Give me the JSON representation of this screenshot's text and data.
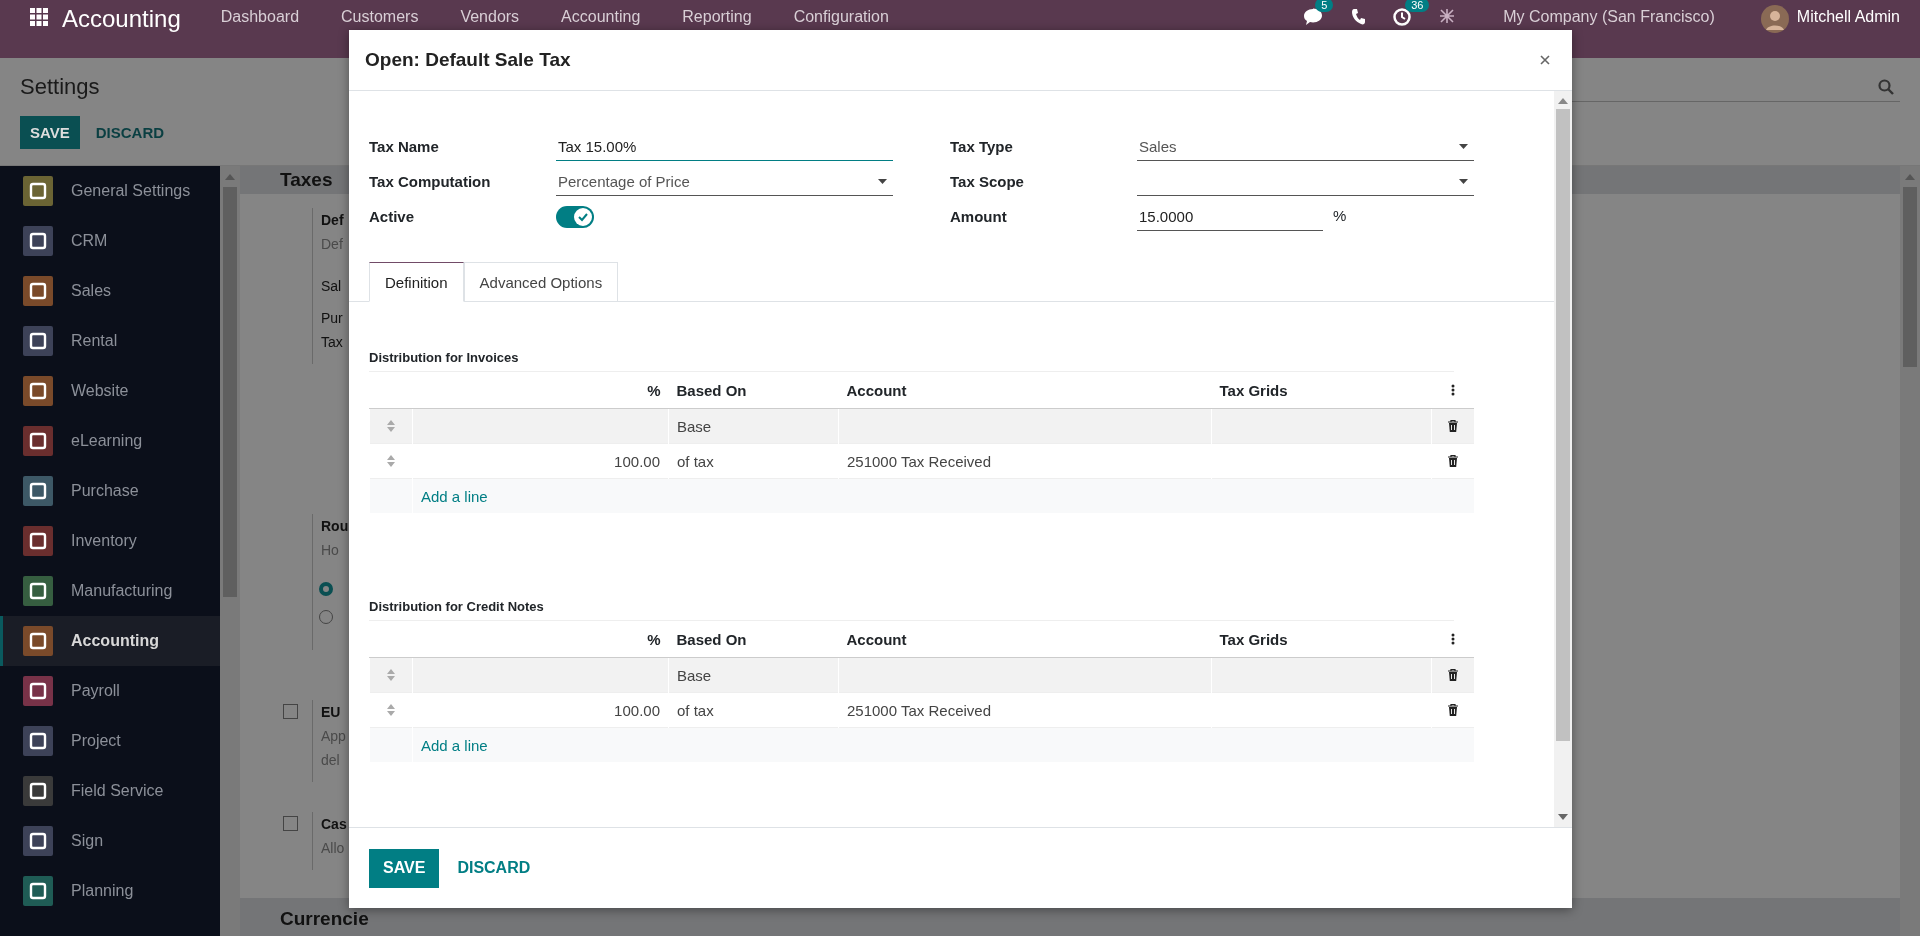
{
  "navbar": {
    "brand": "Accounting",
    "menu": [
      "Dashboard",
      "Customers",
      "Vendors",
      "Accounting",
      "Reporting",
      "Configuration"
    ],
    "messages_badge": "5",
    "activities_badge": "36",
    "company": "My Company (San Francisco)",
    "user": "Mitchell Admin"
  },
  "control_panel": {
    "breadcrumb": "Settings",
    "buttons": [
      "SAVE",
      "DISCARD"
    ]
  },
  "sidebar": {
    "items": [
      {
        "label": "General Settings",
        "color": "#6b6434",
        "selected": false
      },
      {
        "label": "CRM",
        "color": "#3d4258",
        "selected": false
      },
      {
        "label": "Sales",
        "color": "#7a4a2a",
        "selected": false
      },
      {
        "label": "Rental",
        "color": "#3d4258",
        "selected": false
      },
      {
        "label": "Website",
        "color": "#7a4a2a",
        "selected": false
      },
      {
        "label": "eLearning",
        "color": "#6a2e2e",
        "selected": false
      },
      {
        "label": "Purchase",
        "color": "#3d5866",
        "selected": false
      },
      {
        "label": "Inventory",
        "color": "#6a2e2e",
        "selected": false
      },
      {
        "label": "Manufacturing",
        "color": "#365e40",
        "selected": false
      },
      {
        "label": "Accounting",
        "color": "#7a4a2a",
        "selected": true
      },
      {
        "label": "Payroll",
        "color": "#783248",
        "selected": false
      },
      {
        "label": "Project",
        "color": "#3d4258",
        "selected": false
      },
      {
        "label": "Field Service",
        "color": "#3a3a3a",
        "selected": false
      },
      {
        "label": "Sign",
        "color": "#3d4258",
        "selected": false
      },
      {
        "label": "Planning",
        "color": "#1f5c55",
        "selected": false
      }
    ]
  },
  "settings": {
    "section": "Taxes",
    "blocks": [
      {
        "kind": "plain",
        "lines": [
          "Def",
          "Def",
          "Sal",
          "Pur",
          "Tax"
        ]
      },
      {
        "kind": "radio",
        "lines": [
          "Rou",
          "Ho"
        ],
        "radios": [
          {
            "selected": true
          },
          {
            "selected": false
          }
        ]
      },
      {
        "kind": "checkbox",
        "checked": false,
        "lines": [
          "EU",
          "App",
          "del"
        ]
      },
      {
        "kind": "checkbox",
        "checked": false,
        "lines": [
          "Cas",
          "Allo"
        ]
      }
    ],
    "next_section": "Currencie"
  },
  "dialog": {
    "title": "Open: Default Sale Tax",
    "fields": [
      {
        "label": "Tax Name",
        "kind": "input",
        "value": "Tax 15.00%",
        "focused": true
      },
      {
        "label": "Tax Type",
        "kind": "select",
        "value": "Sales"
      },
      {
        "label": "Tax Computation",
        "kind": "select",
        "value": "Percentage of Price"
      },
      {
        "label": "Tax Scope",
        "kind": "select"
      },
      {
        "label": "Active",
        "kind": "toggle",
        "on": true
      },
      {
        "label": "Amount",
        "kind": "input",
        "value": "15.0000",
        "suffix": "%",
        "focused": false
      }
    ],
    "tabs": [
      {
        "label": "Definition",
        "selected": true
      },
      {
        "label": "Advanced Options",
        "selected": false
      }
    ],
    "tables": [
      {
        "title": "Distribution for Invoices",
        "columns": [
          "%",
          "Based On",
          "Account",
          "Tax Grids"
        ],
        "rows": [
          {
            "based_on": "Base"
          },
          {
            "percent": "100.00",
            "based_on": "of tax",
            "account": "251000 Tax Received"
          }
        ],
        "add_line": "Add a line"
      },
      {
        "title": "Distribution for Credit Notes",
        "columns": [
          "%",
          "Based On",
          "Account",
          "Tax Grids"
        ],
        "rows": [
          {
            "based_on": "Base"
          },
          {
            "percent": "100.00",
            "based_on": "of tax",
            "account": "251000 Tax Received"
          }
        ],
        "add_line": "Add a line"
      }
    ],
    "buttons": [
      "SAVE",
      "DISCARD"
    ]
  }
}
